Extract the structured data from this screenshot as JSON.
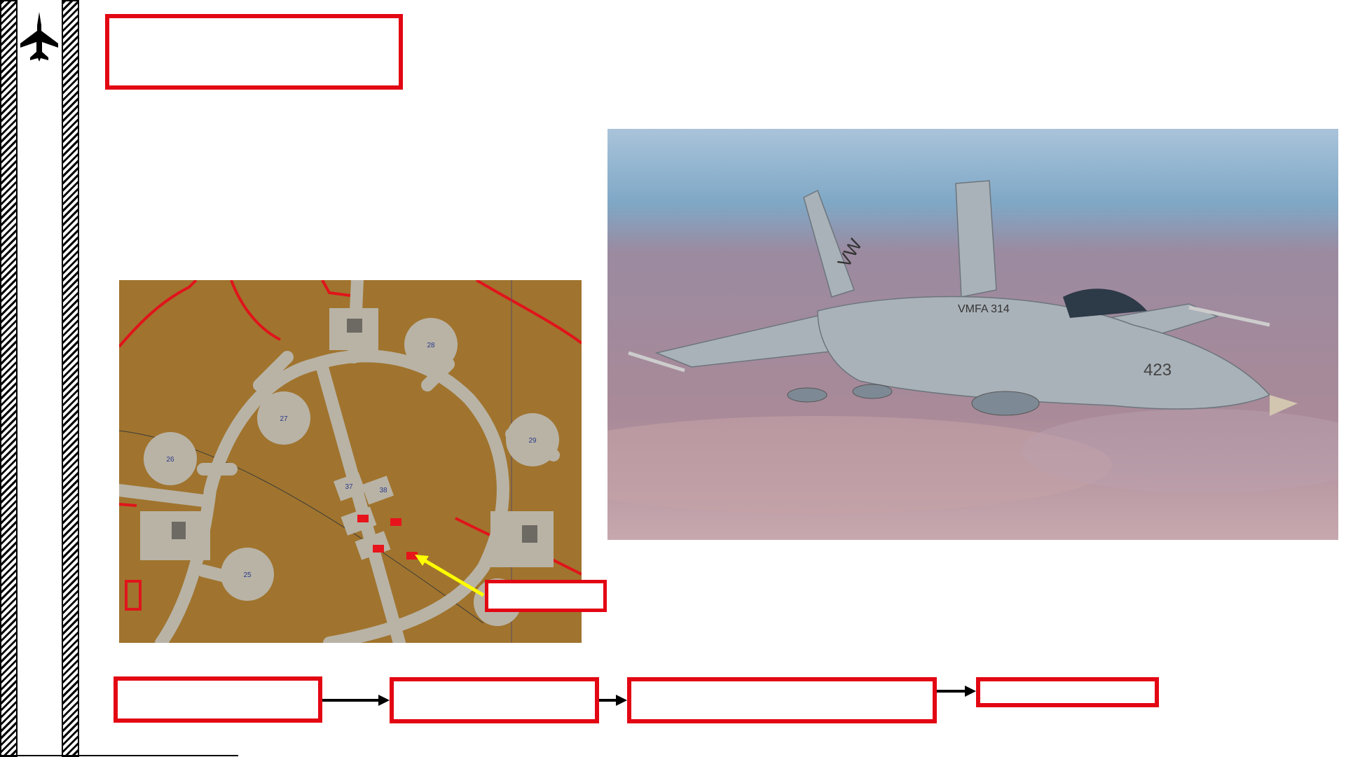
{
  "icons": {
    "aircraft": "fighter-jet-icon"
  },
  "callouts": {
    "title": "",
    "map_label": "",
    "step1": "",
    "step2": "",
    "step3": "",
    "step4": ""
  },
  "map": {
    "pad_labels": [
      "28",
      "27",
      "26",
      "29",
      "37",
      "38",
      "25"
    ],
    "colors": {
      "ground": "#a0742e",
      "taxiway": "#b9b3a6",
      "boundary": "#e0141b",
      "highlight": "#e8141b",
      "arrow": "#ffff00"
    }
  },
  "photo": {
    "tail_code": "VW",
    "fuselage_text": "VMFA 314",
    "nose_number": "423"
  },
  "colors": {
    "callout_border": "#e30613",
    "arrow": "#000000"
  }
}
